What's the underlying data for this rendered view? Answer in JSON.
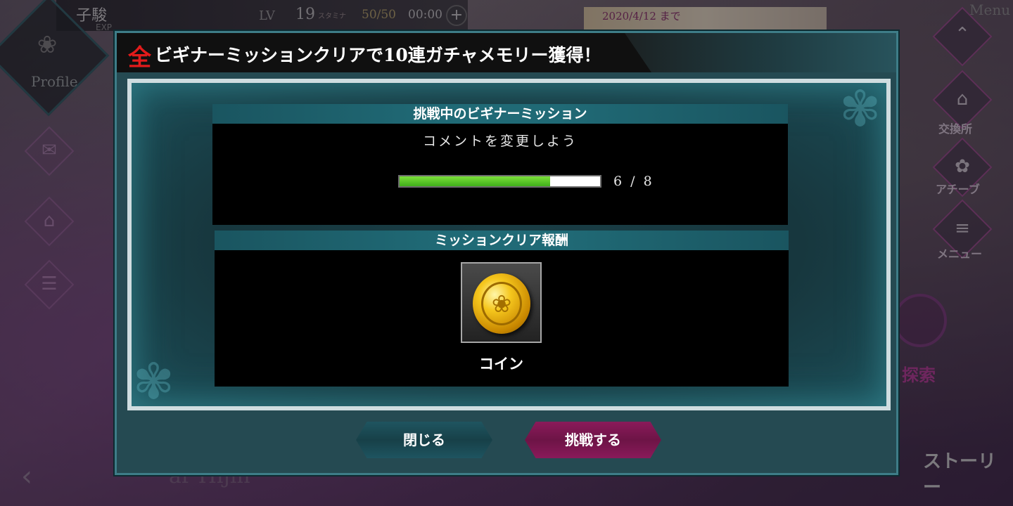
{
  "background": {
    "player_name": "子駿",
    "exp_label": "EXP",
    "lv_label": "LV",
    "level": "19",
    "stamina_label": "スタミナ",
    "stamina_value": "50/50",
    "timer": "00:00",
    "plus_icon": "plus-icon",
    "profile_label": "Profile",
    "event_date": "2020/4/12 まで",
    "menu_label": "Menu",
    "nav": [
      {
        "label": "交換所",
        "icon": "shop-icon"
      },
      {
        "label": "アチーブ",
        "icon": "achievement-icon"
      },
      {
        "label": "メニュー",
        "icon": "menu-icon"
      }
    ],
    "explore_label": "探索",
    "story_label": "ストーリー",
    "bottom_text": "ar Hijin"
  },
  "modal": {
    "header_kanji": "全",
    "header_title": "ビギナーミッションクリアで10連ガチャメモリー獲得！",
    "mission_section": {
      "title": "挑戦中のビギナーミッション",
      "mission_text": "コメントを変更しよう",
      "progress_current": 6,
      "progress_total": 8,
      "progress_text": "6 / 8"
    },
    "reward_section": {
      "title": "ミッションクリア報酬",
      "reward_icon": "coin-icon",
      "reward_name": "コイン"
    },
    "buttons": {
      "close_label": "閉じる",
      "challenge_label": "挑戦する"
    },
    "colors": {
      "accent_red": "#e21b1b",
      "teal": "#206a76",
      "challenge_magenta": "#8a1a5a",
      "progress_green": "#5cc52a"
    }
  }
}
